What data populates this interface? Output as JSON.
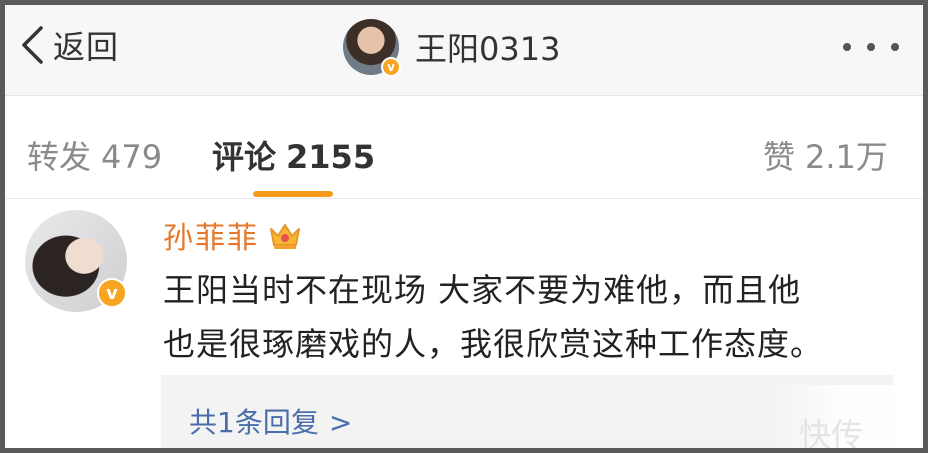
{
  "navbar": {
    "back_label": "返回",
    "title": "王阳0313",
    "verified_mark": "v"
  },
  "tabs": {
    "repost": {
      "label": "转发",
      "count": "479"
    },
    "comments": {
      "label": "评论",
      "count": "2155"
    },
    "likes": {
      "label": "赞",
      "count": "2.1万"
    }
  },
  "comment": {
    "author": "孙菲菲",
    "verified_mark": "v",
    "line1": "王阳当时不在现场 大家不要为难他，而且他",
    "line2": "也是很琢磨戏的人，我很欣赏这种工作态度。",
    "replies_label": "共1条回复",
    "replies_arrow": ">"
  },
  "watermark": "快传",
  "colors": {
    "accent_orange": "#f79b1f",
    "author_name": "#e6782b",
    "reply_link": "#4a6ea9",
    "verified_badge": "#f7a421"
  },
  "icons": [
    "chevron-left-icon",
    "more-dots-icon",
    "crown-icon",
    "verified-badge-icon"
  ]
}
